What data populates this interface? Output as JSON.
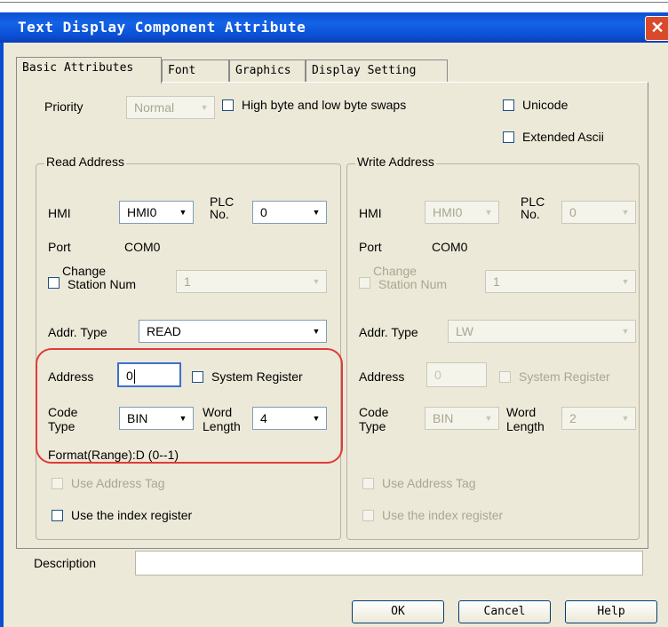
{
  "window": {
    "title": "Text Display Component Attribute",
    "close_glyph": "✕"
  },
  "tabs": [
    "Basic Attributes",
    "Font",
    "Graphics",
    "Display Setting"
  ],
  "priority": {
    "label": "Priority",
    "value": "Normal"
  },
  "options": {
    "byte_swap": "High byte and low byte swaps",
    "unicode": "Unicode",
    "extended_ascii": "Extended Ascii"
  },
  "read": {
    "title": "Read Address",
    "hmi_label": "HMI",
    "hmi_value": "HMI0",
    "plc_label_1": "PLC",
    "plc_label_2": "No.",
    "plc_value": "0",
    "port_label": "Port",
    "port_value": "COM0",
    "change_label_1": "Change",
    "change_label_2": "Station Num",
    "station_value": "1",
    "addr_type_label": "Addr. Type",
    "addr_type_value": "READ",
    "address_label": "Address",
    "address_value": "0",
    "system_register": "System Register",
    "code_type_1": "Code",
    "code_type_2": "Type",
    "code_type_value": "BIN",
    "word_length_1": "Word",
    "word_length_2": "Length",
    "word_length_value": "4",
    "format": "Format(Range):D (0--1)",
    "use_tag": "Use Address Tag",
    "use_index": "Use the index register"
  },
  "write": {
    "title": "Write Address",
    "hmi_label": "HMI",
    "hmi_value": "HMI0",
    "plc_label_1": "PLC",
    "plc_label_2": "No.",
    "plc_value": "0",
    "port_label": "Port",
    "port_value": "COM0",
    "change_label_1": "Change",
    "change_label_2": "Station Num",
    "station_value": "1",
    "addr_type_label": "Addr. Type",
    "addr_type_value": "LW",
    "address_label": "Address",
    "address_value": "0",
    "system_register": "System Register",
    "code_type_1": "Code",
    "code_type_2": "Type",
    "code_type_value": "BIN",
    "word_length_1": "Word",
    "word_length_2": "Length",
    "word_length_value": "2",
    "use_tag": "Use Address Tag",
    "use_index": "Use the index register"
  },
  "description": {
    "label": "Description",
    "value": ""
  },
  "buttons": {
    "ok": "OK",
    "cancel": "Cancel",
    "help": "Help"
  },
  "colors": {
    "title_bar": "#0a4fd3",
    "dialog_bg": "#ece9d8",
    "highlight": "#e03a3a"
  },
  "icons": {
    "dropdown": "chevron-down-icon",
    "close": "close-icon"
  }
}
